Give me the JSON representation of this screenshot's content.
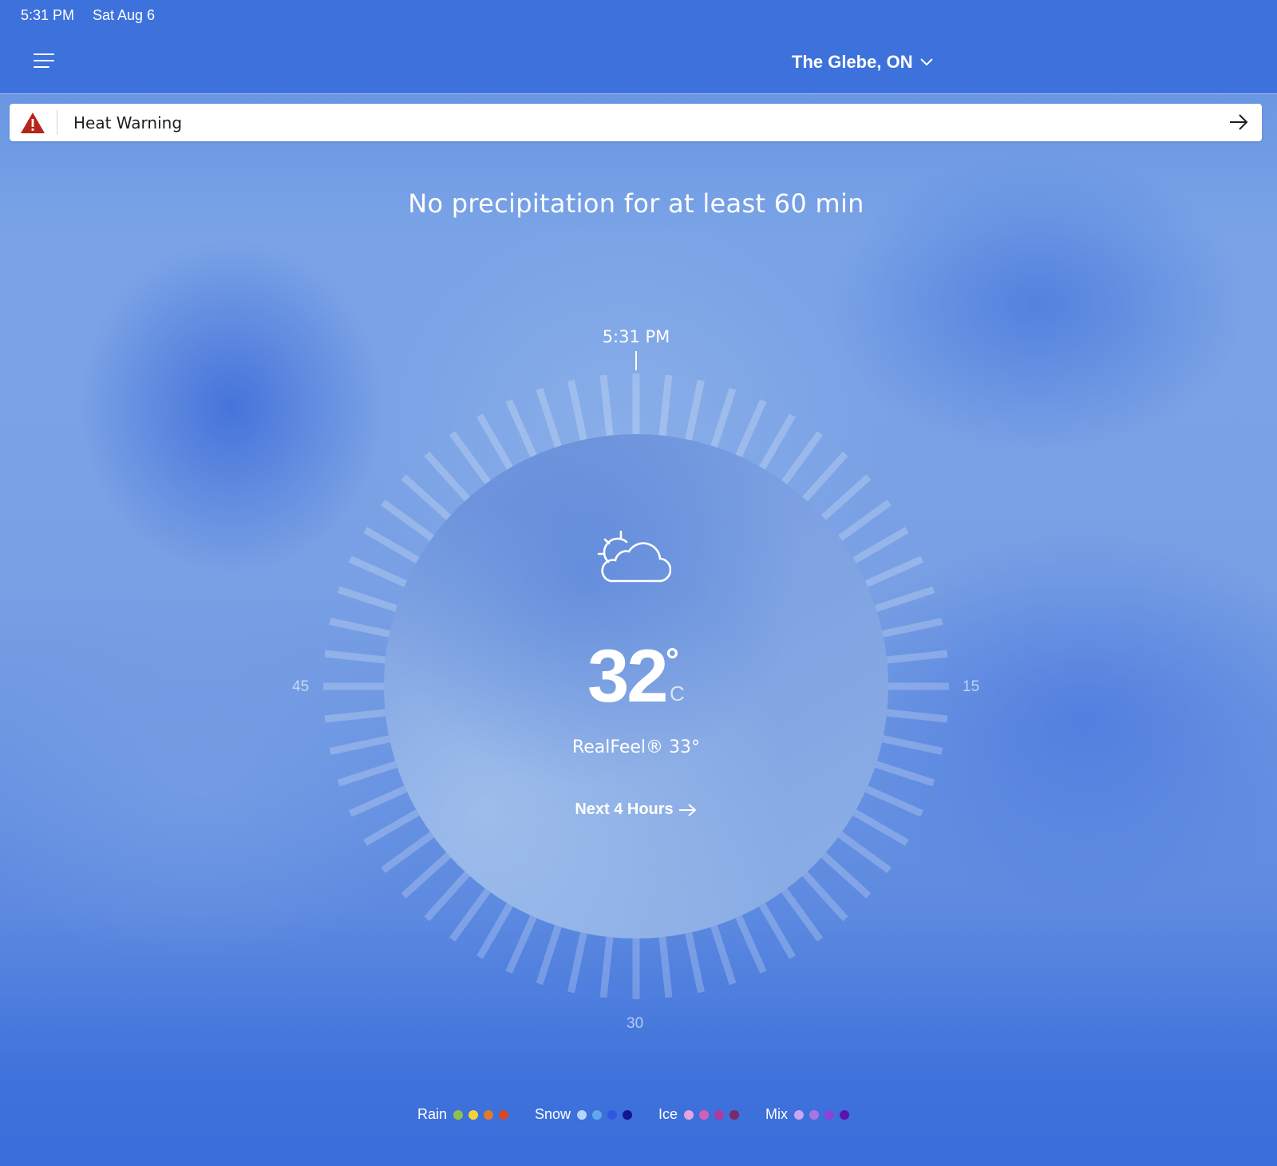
{
  "status_bar": {
    "time": "5:31 PM",
    "date": "Sat Aug 6"
  },
  "header": {
    "location": "The Glebe, ON"
  },
  "alert": {
    "label": "Heat Warning",
    "color": "#b5251c"
  },
  "headline": "No precipitation for at least 60 min",
  "dial": {
    "now_label": "5:31 PM",
    "labels": {
      "right": "15",
      "bottom": "30",
      "left": "45"
    },
    "minutes": 60
  },
  "current": {
    "icon": "partly-cloudy-icon",
    "temperature": "32",
    "degree": "°",
    "unit": "C",
    "realfeel": "RealFeel® 33°",
    "next_hours": "Next 4 Hours"
  },
  "legend": [
    {
      "name": "Rain",
      "colors": [
        "#8fc14d",
        "#f2d23a",
        "#e07a2c",
        "#d44a2a"
      ]
    },
    {
      "name": "Snow",
      "colors": [
        "#b8d6f5",
        "#5ea8ec",
        "#2f58e0",
        "#14168c"
      ]
    },
    {
      "name": "Ice",
      "colors": [
        "#e6a3e0",
        "#d35fb8",
        "#b03a9c",
        "#7a2a6a"
      ]
    },
    {
      "name": "Mix",
      "colors": [
        "#c9a7ee",
        "#a877e4",
        "#8a44d8",
        "#5a15b0"
      ]
    }
  ]
}
